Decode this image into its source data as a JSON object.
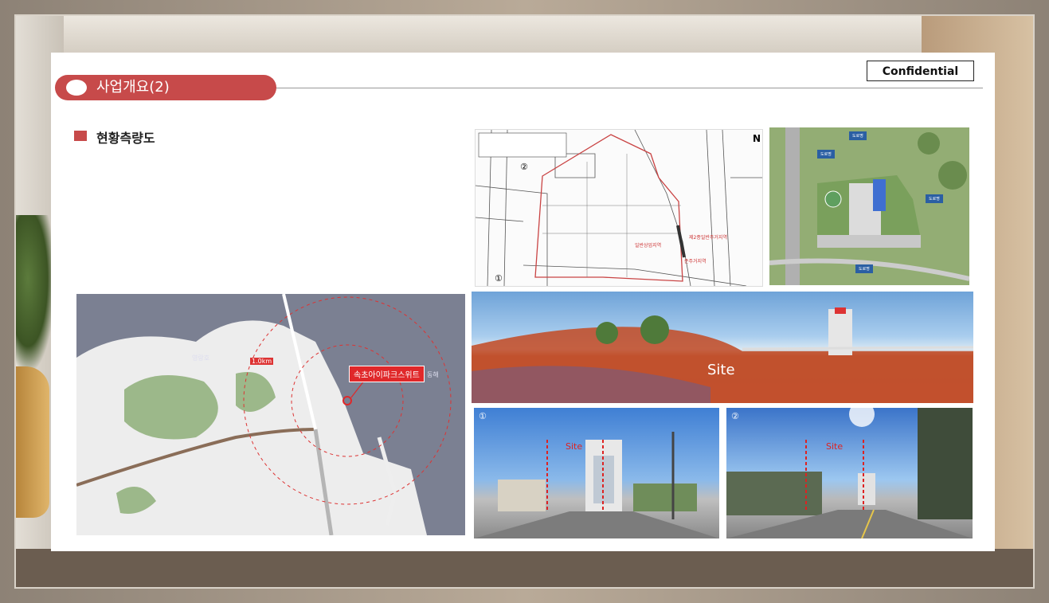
{
  "slide": {
    "confidential": "Confidential",
    "title": "사업개요(2)",
    "subtitle": "현황측량도"
  },
  "survey": {
    "circle_a": "②",
    "circle_b": "①",
    "north": "N",
    "zone_1": "일반상업지역",
    "zone_2": "제2종일반주거지역",
    "zone_3": "준주거지역"
  },
  "plan": {
    "labels": [
      "도로명",
      "도로명",
      "도로명",
      "도로명"
    ]
  },
  "map": {
    "callout": "속초아이파크스위트",
    "lake": "영랑호",
    "sea": "동해",
    "ring": "1.0km"
  },
  "photos": {
    "pano_site": "Site",
    "street1_num": "①",
    "street1_site": "Site",
    "street2_num": "②",
    "street2_site": "Site"
  },
  "colors": {
    "accent": "#c74a4a",
    "map_marker": "#e0282a"
  }
}
